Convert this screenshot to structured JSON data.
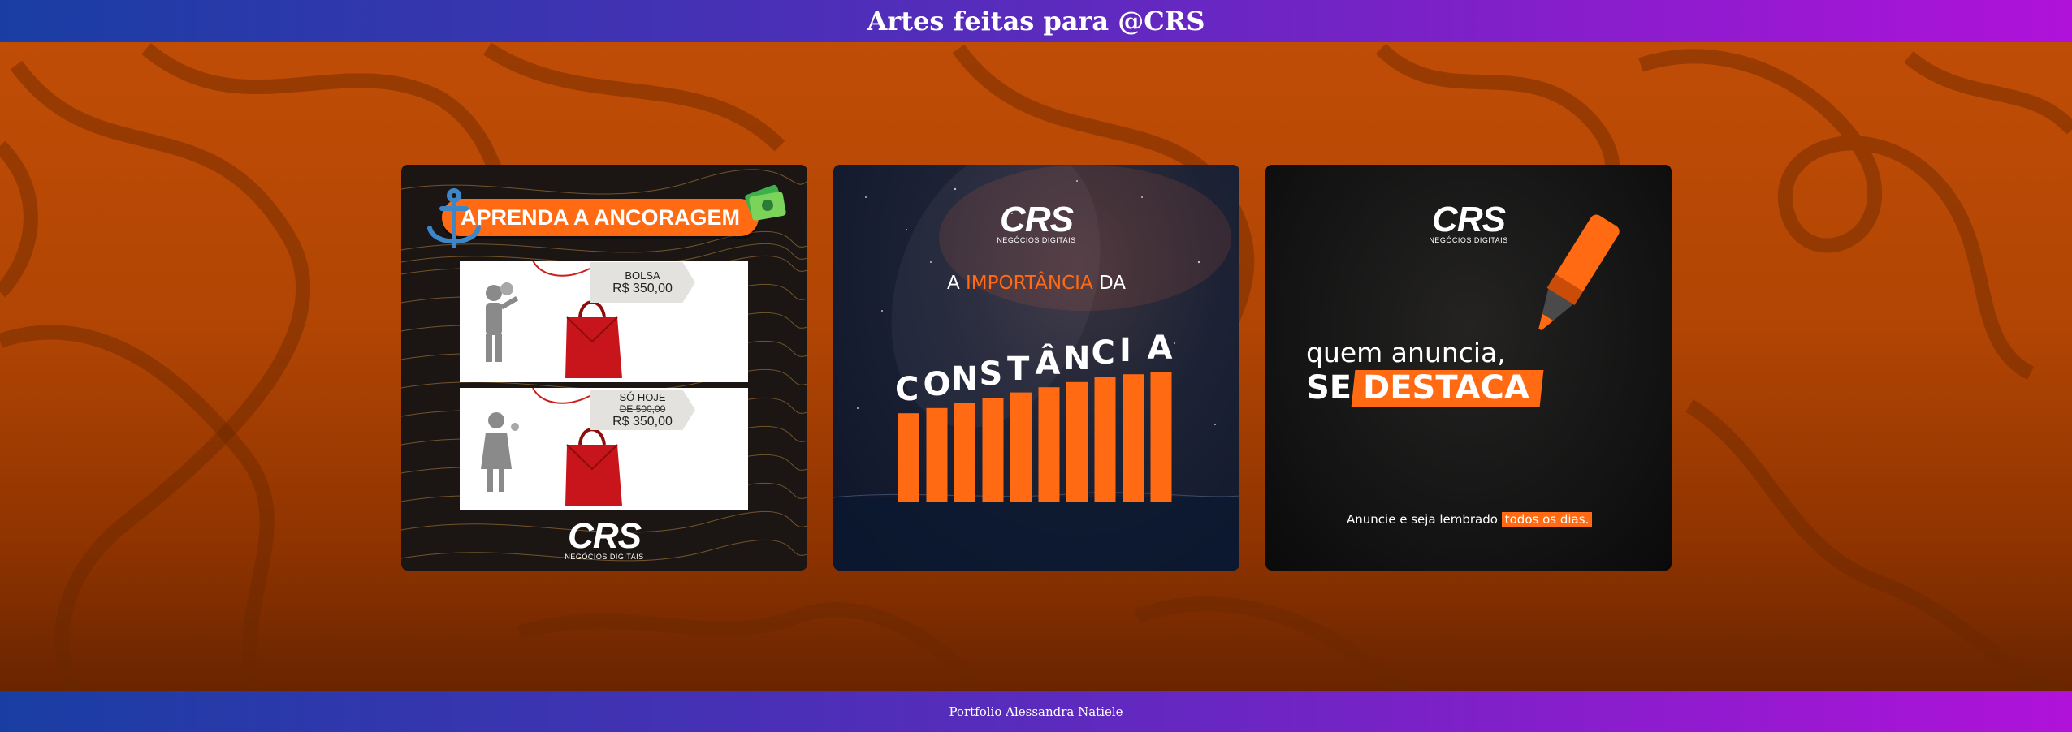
{
  "header": {
    "title": "Artes feitas para @CRS"
  },
  "footer": {
    "text": "Portfolio Alessandra Natiele"
  },
  "colors": {
    "accent": "#ff6a13",
    "bar_start": "#193ea3",
    "bar_end": "#b012d9",
    "background": "#b14504"
  },
  "cards": [
    {
      "banner": "APRENDA A ANCORAGEM",
      "panel1": {
        "label": "BOLSA",
        "price": "R$ 350,00"
      },
      "panel2": {
        "label": "SÓ HOJE",
        "old_price": "DE 500,00",
        "price": "R$ 350,00"
      },
      "logo": "CRS",
      "logo_sub": "NEGÓCIOS DIGITAIS",
      "icons": [
        "anchor-icon",
        "money-icon",
        "man-icon",
        "woman-icon",
        "handbag-icon"
      ]
    },
    {
      "logo": "CRS",
      "logo_sub": "NEGÓCIOS DIGITAIS",
      "title_pre": "A ",
      "title_highlight": "IMPORTÂNCIA",
      "title_post": " DA",
      "word_letters": [
        "C",
        "O",
        "N",
        "S",
        "T",
        "Â",
        "N",
        "C",
        "I",
        "A"
      ],
      "bar_levels": [
        0.68,
        0.72,
        0.76,
        0.8,
        0.84,
        0.88,
        0.92,
        0.96,
        0.98,
        1.0
      ]
    },
    {
      "logo": "CRS",
      "logo_sub": "NEGÓCIOS DIGITAIS",
      "line1": "quem anuncia,",
      "line2_pre": "SE",
      "line2_highlight": "DESTACA",
      "footer_pre": "Anuncie e seja lembrado",
      "footer_highlight": "todos os dias.",
      "icons": [
        "marker-icon"
      ]
    }
  ]
}
